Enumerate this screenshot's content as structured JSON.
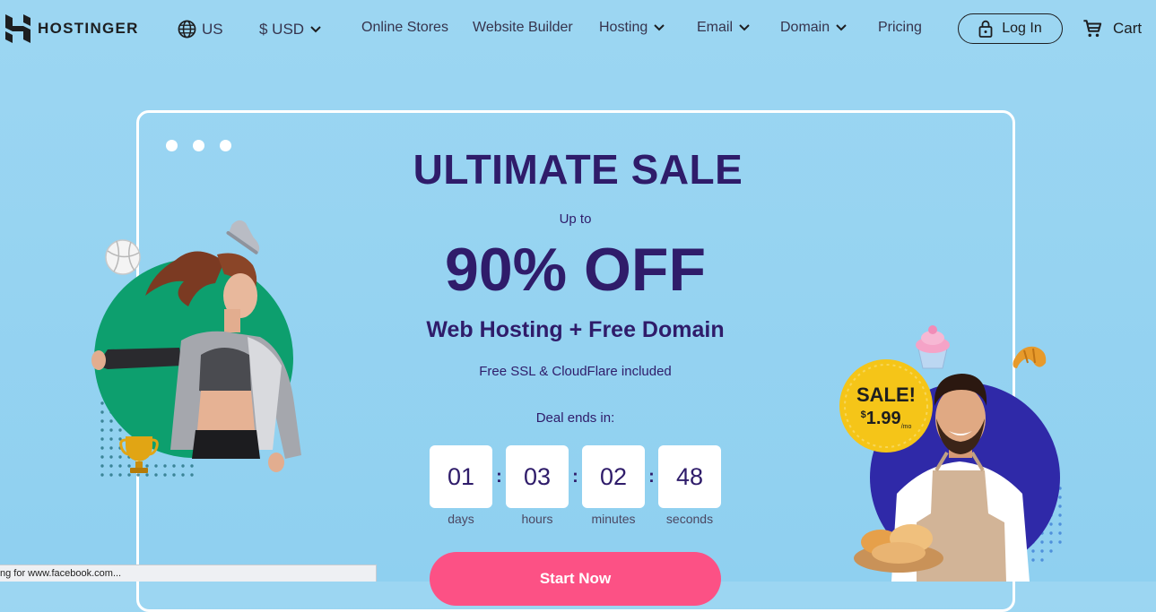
{
  "brand": {
    "name": "HOSTINGER"
  },
  "nav": {
    "region": "US",
    "currency": "$ USD",
    "items": [
      {
        "label": "Online Stores",
        "dropdown": false
      },
      {
        "label": "Website Builder",
        "dropdown": false
      },
      {
        "label": "Hosting",
        "dropdown": true
      },
      {
        "label": "Email",
        "dropdown": true
      },
      {
        "label": "Domain",
        "dropdown": true
      },
      {
        "label": "Pricing",
        "dropdown": false
      }
    ],
    "login": "Log In",
    "cart": "Cart"
  },
  "hero": {
    "title": "ULTIMATE SALE",
    "upto": "Up to",
    "discount": "90% OFF",
    "subtitle": "Web Hosting + Free Domain",
    "features": "Free SSL & CloudFlare included",
    "deal_label": "Deal ends in:",
    "countdown": [
      {
        "value": "01",
        "label": "days"
      },
      {
        "value": "03",
        "label": "hours"
      },
      {
        "value": "02",
        "label": "minutes"
      },
      {
        "value": "48",
        "label": "seconds"
      }
    ],
    "cta": "Start Now"
  },
  "badge": {
    "title": "SALE!",
    "currency": "$",
    "price": "1.99",
    "period": "/mo"
  },
  "status": {
    "text": "ng for www.facebook.com..."
  },
  "colors": {
    "background": "#9cd6f2",
    "heading": "#2f1c6a",
    "cta": "#fc5185",
    "green_circle": "#0d9f6e",
    "purple_circle": "#2f29a8",
    "badge_yellow": "#f5c518"
  },
  "icons": [
    "hostinger-logo-icon",
    "globe-icon",
    "chevron-down-icon",
    "lock-icon",
    "cart-icon"
  ]
}
